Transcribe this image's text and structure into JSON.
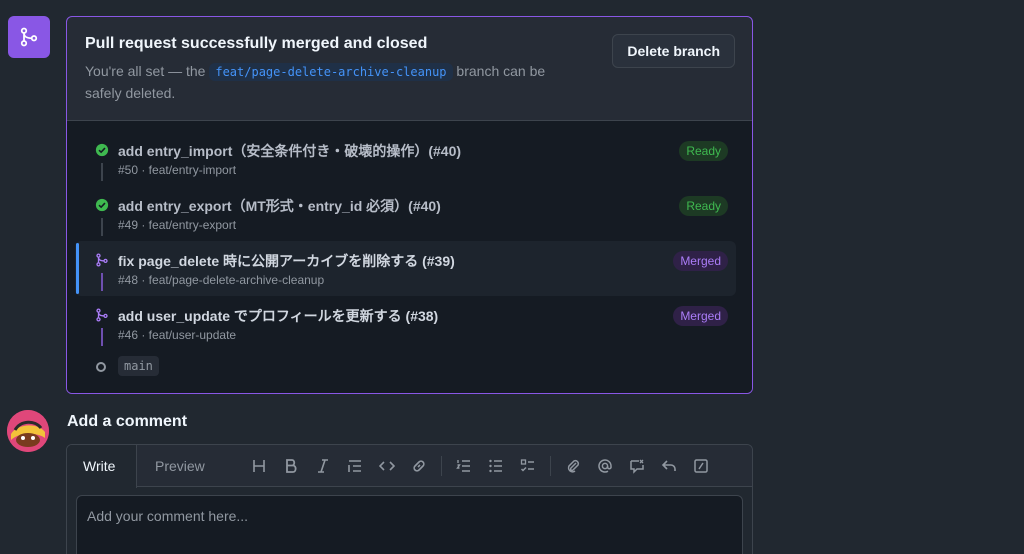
{
  "merge": {
    "title": "Pull request successfully merged and closed",
    "desc_prefix": "You're all set — the",
    "branch": "feat/page-delete-archive-cleanup",
    "desc_suffix": "branch can be safely deleted.",
    "delete_button": "Delete branch",
    "accent": "#8957e5"
  },
  "stack": {
    "items": [
      {
        "title": "add entry_import（安全条件付き・破壊的操作）(#40)",
        "meta": "#50 · feat/entry-import",
        "status": "Ready",
        "icon": "check-circle-icon"
      },
      {
        "title": "add entry_export（MT形式・entry_id 必須）(#40)",
        "meta": "#49 · feat/entry-export",
        "status": "Ready",
        "icon": "check-circle-icon"
      },
      {
        "title": "fix page_delete 時に公開アーカイブを削除する (#39)",
        "meta": "#48 · feat/page-delete-archive-cleanup",
        "status": "Merged",
        "icon": "git-merge-icon"
      },
      {
        "title": "add user_update でプロフィールを更新する (#38)",
        "meta": "#46 · feat/user-update",
        "status": "Merged",
        "icon": "git-merge-icon"
      }
    ],
    "base": "main"
  },
  "comment": {
    "heading": "Add a comment",
    "tab_write": "Write",
    "tab_preview": "Preview",
    "placeholder": "Add your comment here..."
  }
}
